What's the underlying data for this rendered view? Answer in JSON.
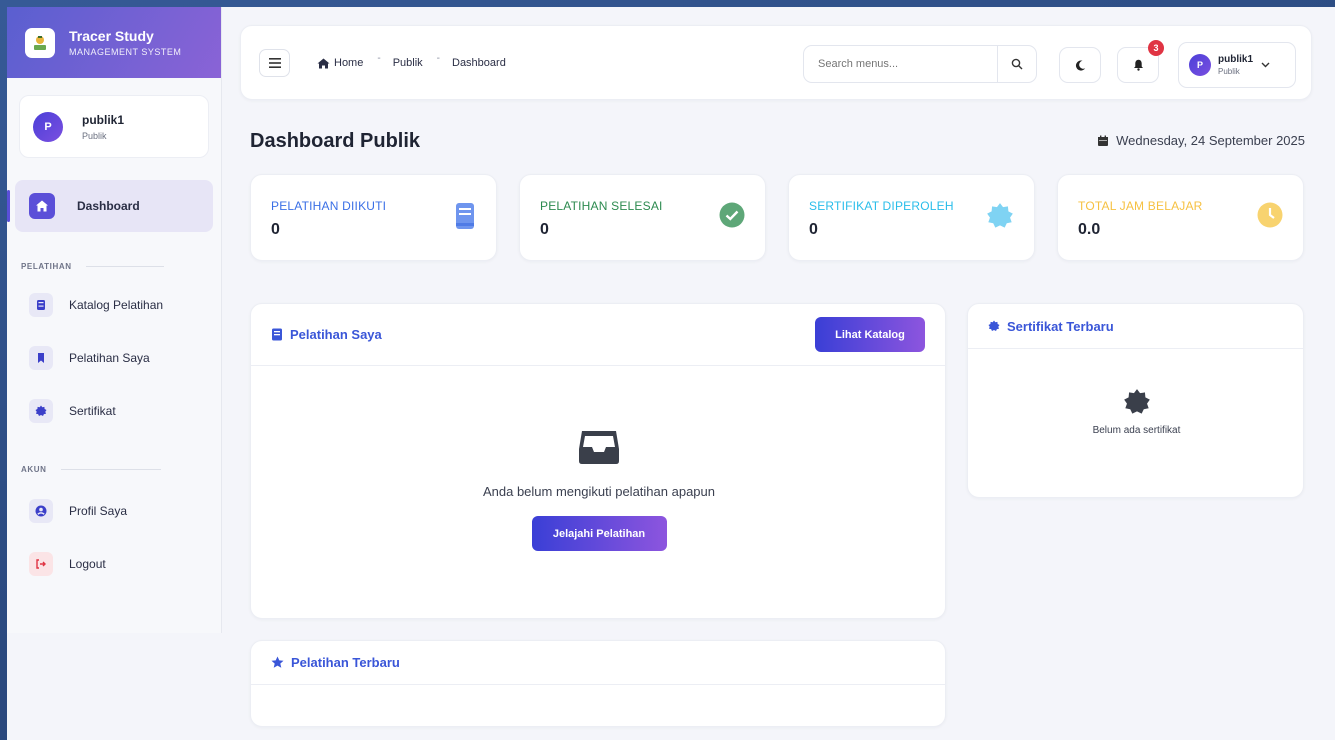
{
  "brand": {
    "title": "Tracer Study",
    "subtitle": "MANAGEMENT SYSTEM"
  },
  "user": {
    "name": "publik1",
    "role": "Publik",
    "initial": "P"
  },
  "sidebar": {
    "active": {
      "label": "Dashboard"
    },
    "sections": [
      {
        "label": "PELATIHAN",
        "items": [
          {
            "label": "Katalog Pelatihan",
            "icon": "book-icon"
          },
          {
            "label": "Pelatihan Saya",
            "icon": "bookmark-icon"
          },
          {
            "label": "Sertifikat",
            "icon": "certificate-icon"
          }
        ]
      },
      {
        "label": "AKUN",
        "items": [
          {
            "label": "Profil Saya",
            "icon": "user-circle-icon"
          },
          {
            "label": "Logout",
            "icon": "logout-icon"
          }
        ]
      }
    ]
  },
  "topbar": {
    "breadcrumb": [
      "Home",
      "Publik",
      "Dashboard"
    ],
    "search_placeholder": "Search menus...",
    "notification_count": "3"
  },
  "page": {
    "title": "Dashboard Publik",
    "date": "Wednesday, 24 September 2025"
  },
  "stats": [
    {
      "label": "PELATIHAN DIIKUTI",
      "value": "0",
      "color": "#3a6fe6"
    },
    {
      "label": "PELATIHAN SELESAI",
      "value": "0",
      "color": "#2c8a4f"
    },
    {
      "label": "SERTIFIKAT DIPEROLEH",
      "value": "0",
      "color": "#29bdea"
    },
    {
      "label": "TOTAL JAM BELAJAR",
      "value": "0.0",
      "color": "#f6c142"
    }
  ],
  "my_training": {
    "title": "Pelatihan Saya",
    "button": "Lihat Katalog",
    "empty_text": "Anda belum mengikuti pelatihan apapun",
    "cta": "Jelajahi Pelatihan"
  },
  "latest_certificates": {
    "title": "Sertifikat Terbaru",
    "empty_text": "Belum ada sertifikat"
  },
  "latest_training": {
    "title": "Pelatihan Terbaru"
  }
}
